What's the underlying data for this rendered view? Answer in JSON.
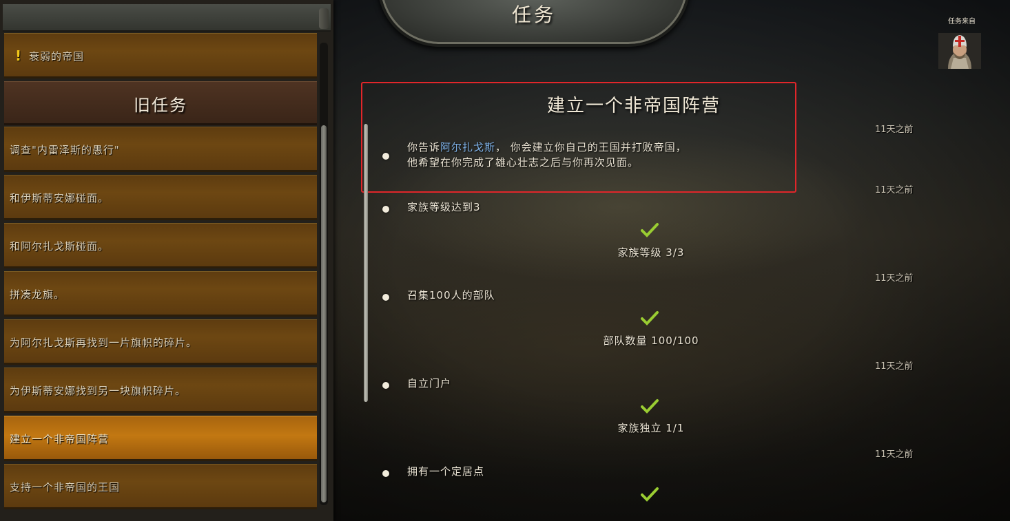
{
  "title": "任务",
  "quest_giver": {
    "label": "任务来自"
  },
  "sidebar": {
    "active_quest": "衰弱的帝国",
    "section_header": "旧任务",
    "items": [
      {
        "label": "调查\"内雷泽斯的愚行\""
      },
      {
        "label": "和伊斯蒂安娜碰面。"
      },
      {
        "label": "和阿尔扎戈斯碰面。"
      },
      {
        "label": "拼凑龙旗。"
      },
      {
        "label": "为阿尔扎戈斯再找到一片旗帜的碎片。"
      },
      {
        "label": "为伊斯蒂安娜找到另一块旗帜碎片。"
      },
      {
        "label": "建立一个非帝国阵营",
        "selected": true
      },
      {
        "label": "支持一个非帝国的王国"
      }
    ]
  },
  "quest": {
    "title": "建立一个非帝国阵营",
    "description": {
      "line1_pre": "你告诉",
      "line1_name": "阿尔扎戈斯",
      "line1_post": "， 你会建立你自己的王国并打败帝国，",
      "line2": "他希望在你完成了雄心壮志之后与你再次见面。"
    },
    "entries": [
      {
        "time": "11天之前"
      },
      {
        "time": "11天之前",
        "text": "家族等级达到3",
        "progress": "家族等级  3/3"
      },
      {
        "time": "11天之前",
        "text": "召集100人的部队",
        "progress": "部队数量  100/100"
      },
      {
        "time": "11天之前",
        "text": "自立门户",
        "progress": "家族独立  1/1"
      },
      {
        "time": "11天之前",
        "text": "拥有一个定居点"
      }
    ]
  },
  "colors": {
    "highlight_border": "#e1262a",
    "check": "#9acd32",
    "name_link": "#7fb3ea",
    "selected_item": "#c27812"
  }
}
